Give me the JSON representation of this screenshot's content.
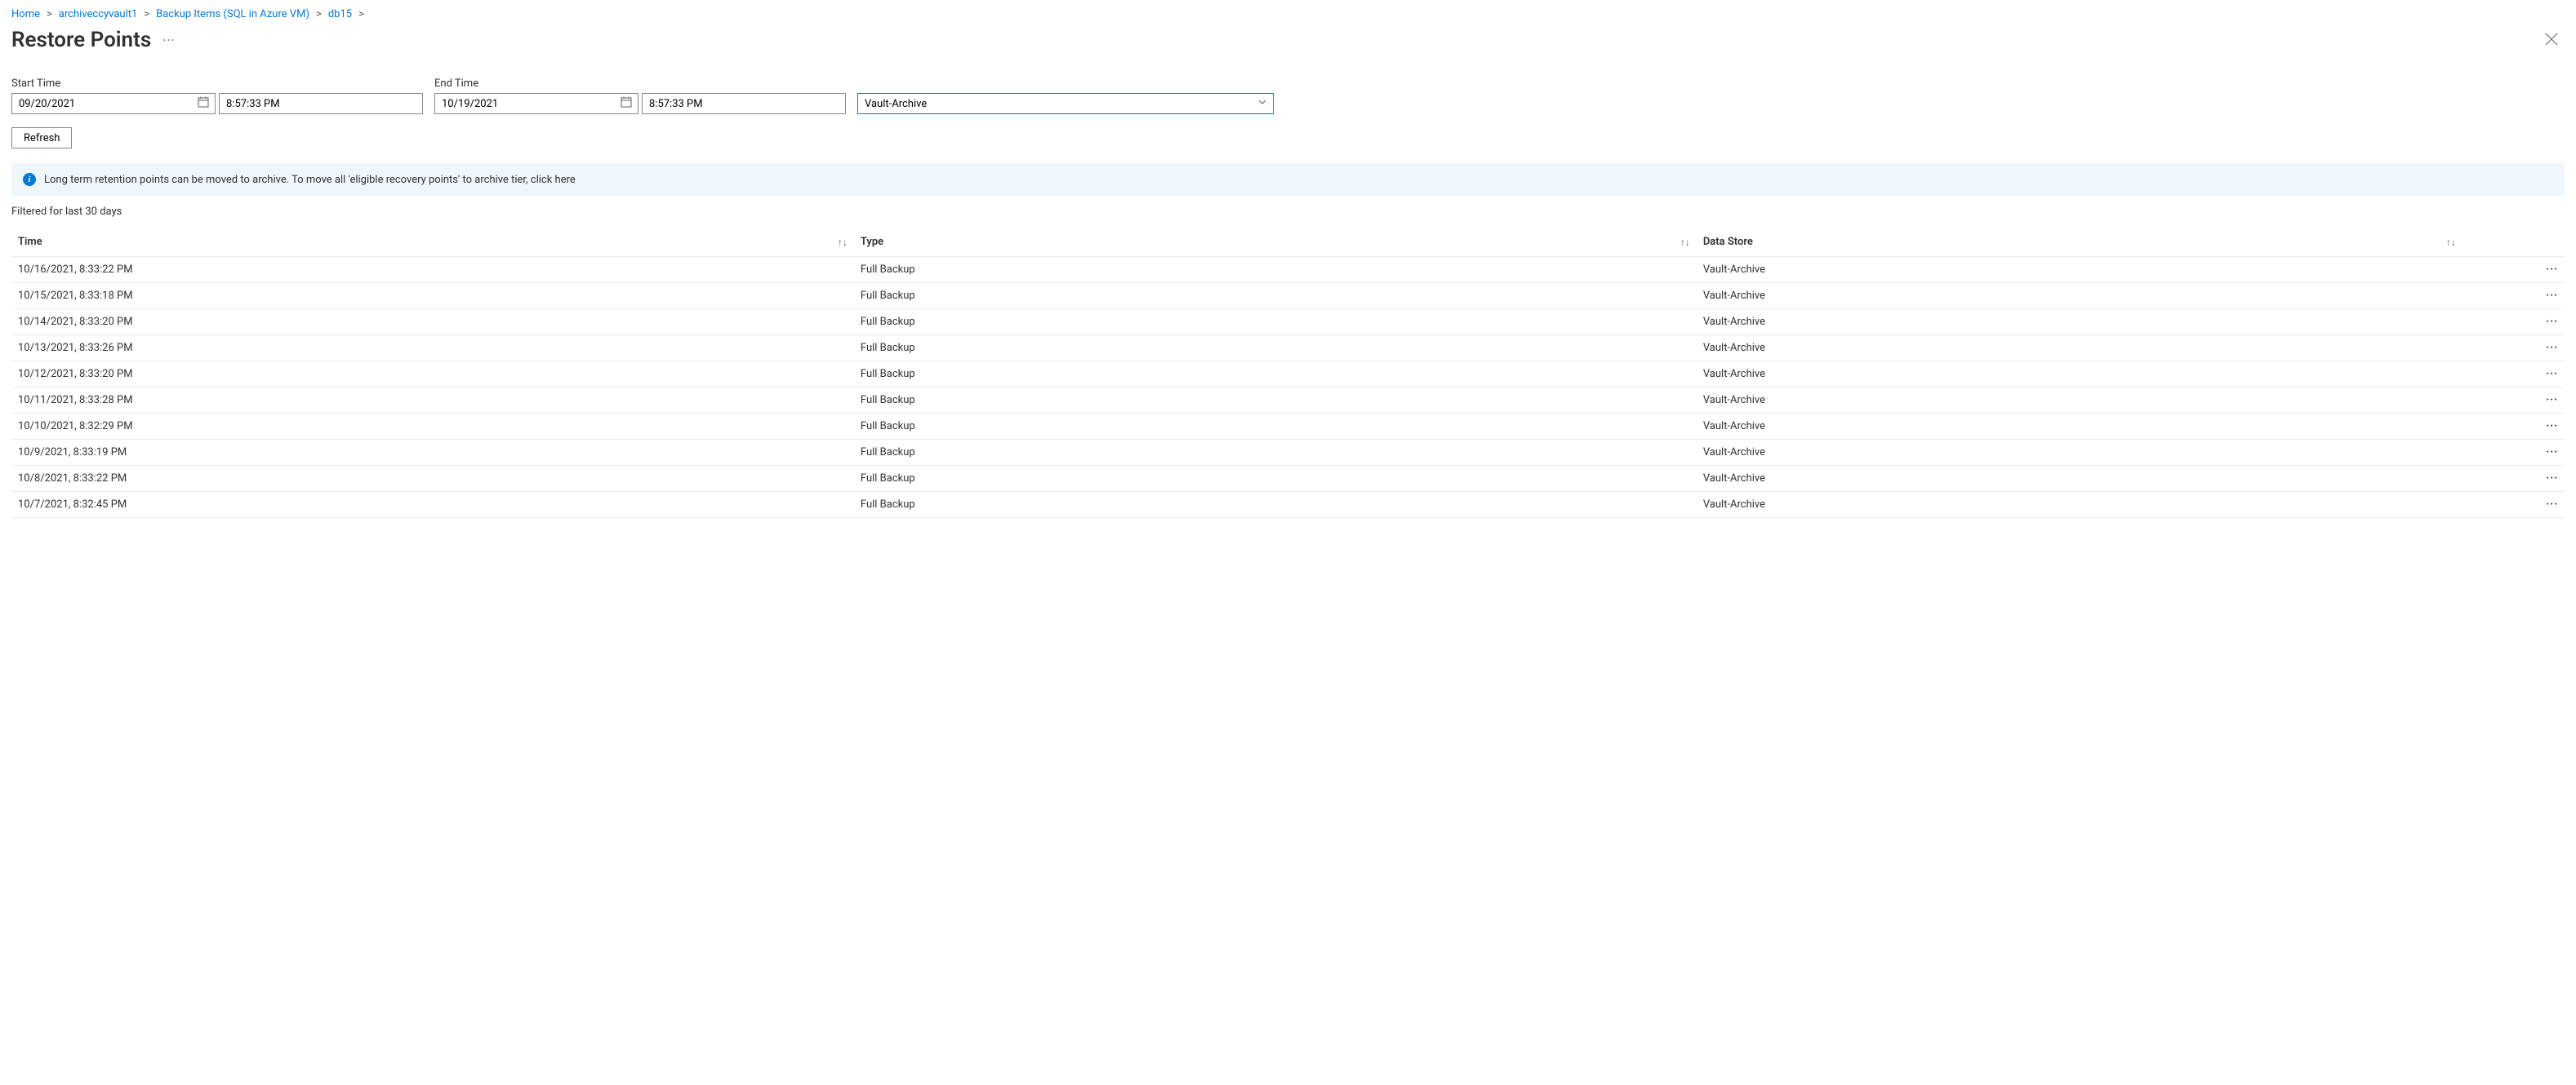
{
  "breadcrumb": {
    "items": [
      "Home",
      "archiveccyvault1",
      "Backup Items (SQL in Azure VM)",
      "db15"
    ]
  },
  "page": {
    "title": "Restore Points"
  },
  "filters": {
    "start_label": "Start Time",
    "start_date": "09/20/2021",
    "start_time": "8:57:33 PM",
    "end_label": "End Time",
    "end_date": "10/19/2021",
    "end_time": "8:57:33 PM",
    "tier_selected": "Vault-Archive",
    "refresh_label": "Refresh"
  },
  "banner": {
    "text": "Long term retention points can be moved to archive. To move all 'eligible recovery points' to archive tier, click here"
  },
  "caption": {
    "text": "Filtered for last 30 days"
  },
  "table": {
    "headers": {
      "time": "Time",
      "type": "Type",
      "store": "Data Store"
    },
    "rows": [
      {
        "time": "10/16/2021, 8:33:22 PM",
        "type": "Full Backup",
        "store": "Vault-Archive"
      },
      {
        "time": "10/15/2021, 8:33:18 PM",
        "type": "Full Backup",
        "store": "Vault-Archive"
      },
      {
        "time": "10/14/2021, 8:33:20 PM",
        "type": "Full Backup",
        "store": "Vault-Archive"
      },
      {
        "time": "10/13/2021, 8:33:26 PM",
        "type": "Full Backup",
        "store": "Vault-Archive"
      },
      {
        "time": "10/12/2021, 8:33:20 PM",
        "type": "Full Backup",
        "store": "Vault-Archive"
      },
      {
        "time": "10/11/2021, 8:33:28 PM",
        "type": "Full Backup",
        "store": "Vault-Archive"
      },
      {
        "time": "10/10/2021, 8:32:29 PM",
        "type": "Full Backup",
        "store": "Vault-Archive"
      },
      {
        "time": "10/9/2021, 8:33:19 PM",
        "type": "Full Backup",
        "store": "Vault-Archive"
      },
      {
        "time": "10/8/2021, 8:33:22 PM",
        "type": "Full Backup",
        "store": "Vault-Archive"
      },
      {
        "time": "10/7/2021, 8:32:45 PM",
        "type": "Full Backup",
        "store": "Vault-Archive"
      }
    ]
  }
}
